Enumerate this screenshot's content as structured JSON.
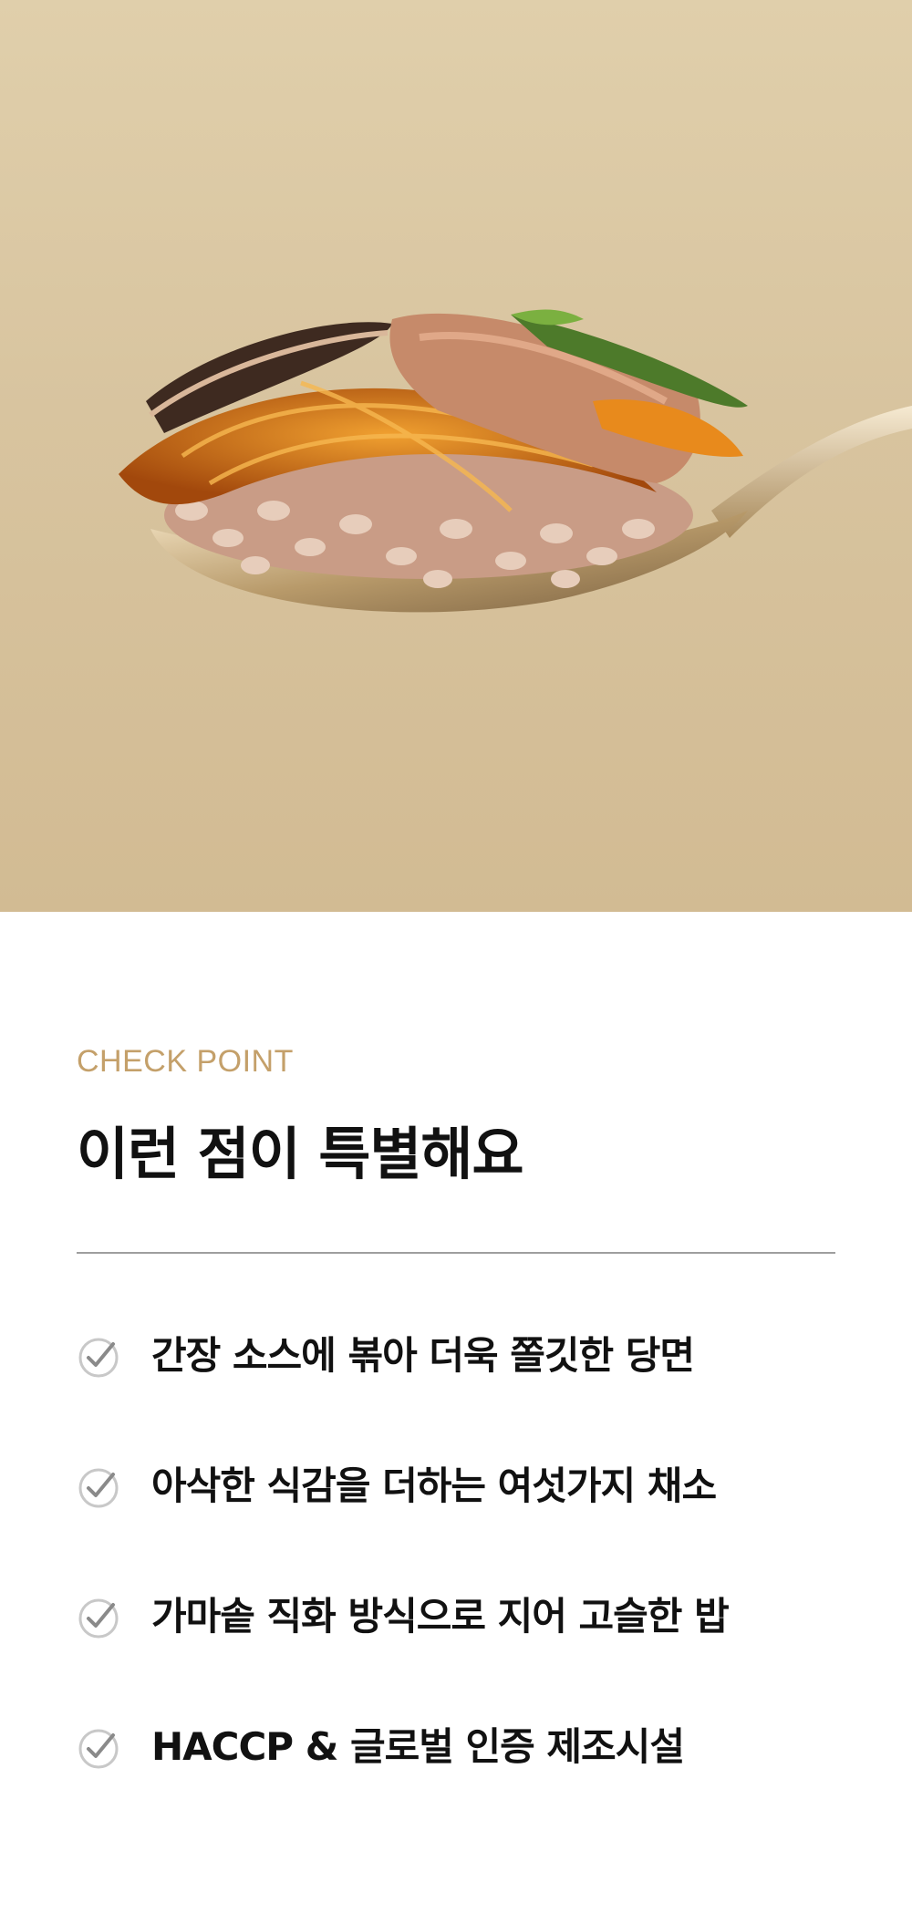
{
  "hero": {
    "image_name": "spoon-with-japchae-rice",
    "background_color": "#d8c49f"
  },
  "section": {
    "eyebrow": "CHECK POINT",
    "eyebrow_color": "#c4a06a",
    "title": "이런 점이 특별해요"
  },
  "checklist": {
    "icon": "check-circle-icon",
    "items": [
      {
        "text": "간장 소스에 볶아 더욱 쫄깃한 당면"
      },
      {
        "text": "아삭한 식감을 더하는 여섯가지 채소"
      },
      {
        "text": "가마솥 직화 방식으로 지어 고슬한 밥"
      },
      {
        "text": "HACCP & 글로벌 인증 제조시설"
      }
    ]
  }
}
